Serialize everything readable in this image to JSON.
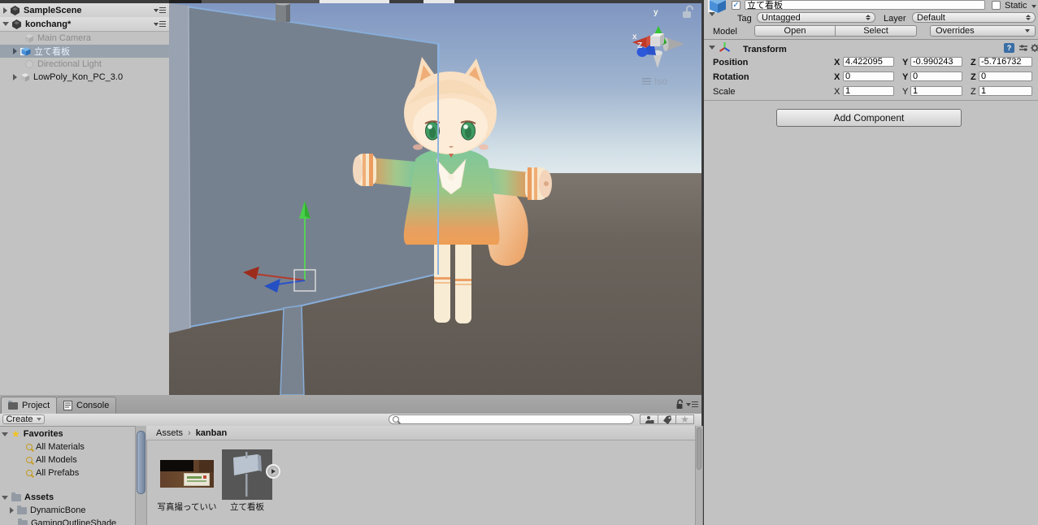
{
  "colors": {
    "selection_bg": "#98a2ad",
    "axis_x": "#b23b2b",
    "axis_y": "#49cf49",
    "axis_z": "#2a52cc",
    "prefab_blue": "#4a90d9",
    "favorites_star": "#f2c31c"
  },
  "icons": {
    "check": "✓",
    "star": "★",
    "breadcrumb_separator": "›",
    "help": "?",
    "play": "▶"
  },
  "hierarchy": {
    "scenes": [
      {
        "name": "SampleScene"
      },
      {
        "name": "konchang*"
      }
    ],
    "items": [
      {
        "label": "Main Camera",
        "state": "inactive"
      },
      {
        "label": "立て看板",
        "state": "selected"
      },
      {
        "label": "Directional Light",
        "state": "inactive"
      },
      {
        "label": "LowPoly_Kon_PC_3.0",
        "state": "normal"
      }
    ]
  },
  "scene_view": {
    "orientation_gizmo": {
      "x_label": "x",
      "y_label": "y",
      "z_label": "Z",
      "projection": "Iso"
    }
  },
  "inspector": {
    "name_value": "立て看板",
    "static_label": "Static",
    "tag": {
      "label": "Tag",
      "value": "Untagged"
    },
    "layer": {
      "label": "Layer",
      "value": "Default"
    },
    "model": {
      "label": "Model",
      "open_button": "Open",
      "select_button": "Select",
      "overrides_dropdown": "Overrides"
    },
    "transform": {
      "title": "Transform",
      "axis": {
        "x": "X",
        "y": "Y",
        "z": "Z"
      },
      "rows": [
        {
          "label": "Position",
          "x": "4.422095",
          "y": "-0.990243",
          "z": "-5.716732"
        },
        {
          "label": "Rotation",
          "x": "0",
          "y": "0",
          "z": "0"
        },
        {
          "label": "Scale",
          "x": "1",
          "y": "1",
          "z": "1"
        }
      ]
    },
    "add_component_button": "Add Component"
  },
  "project": {
    "tabs": [
      {
        "label": "Project"
      },
      {
        "label": "Console"
      }
    ],
    "create_button": "Create",
    "search_placeholder": "",
    "favorites": {
      "title": "Favorites",
      "items": [
        {
          "label": "All Materials"
        },
        {
          "label": "All Models"
        },
        {
          "label": "All Prefabs"
        }
      ]
    },
    "assets_tree": {
      "title": "Assets",
      "items": [
        {
          "label": "DynamicBone"
        },
        {
          "label": "GamingOutlineShade"
        }
      ]
    },
    "breadcrumb": {
      "root": "Assets",
      "current": "kanban"
    },
    "files": [
      {
        "label": "写真撮っていい",
        "type": "texture"
      },
      {
        "label": "立て看板",
        "type": "prefab"
      }
    ]
  }
}
